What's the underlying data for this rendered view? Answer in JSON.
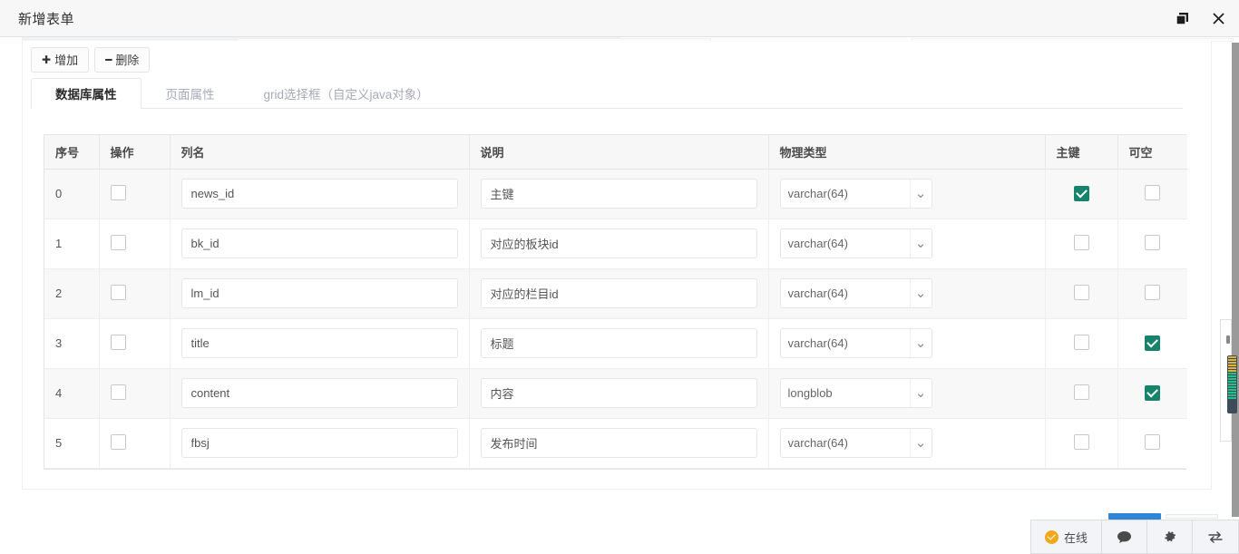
{
  "window": {
    "title": "新增表单",
    "restore_icon": "restore-window-icon",
    "close_icon": "close-icon"
  },
  "toolbar": {
    "add_label": "增加",
    "add_symbol": "✚",
    "delete_label": "删除",
    "delete_symbol": "━"
  },
  "tabs": [
    {
      "label": "数据库属性",
      "active": true
    },
    {
      "label": "页面属性",
      "active": false
    },
    {
      "label": "grid选择框（自定义java对象）",
      "active": false
    }
  ],
  "grid": {
    "columns": [
      {
        "key": "idx",
        "label": "序号"
      },
      {
        "key": "op",
        "label": "操作"
      },
      {
        "key": "col",
        "label": "列名"
      },
      {
        "key": "desc",
        "label": "说明"
      },
      {
        "key": "type",
        "label": "物理类型"
      },
      {
        "key": "pk",
        "label": "主键"
      },
      {
        "key": "null",
        "label": "可空"
      }
    ],
    "type_options": [
      "varchar(64)",
      "longblob"
    ],
    "rows": [
      {
        "idx": "0",
        "col": "news_id",
        "desc": "主键",
        "type": "varchar(64)",
        "pk": true,
        "nullable": false,
        "selected": false
      },
      {
        "idx": "1",
        "col": "bk_id",
        "desc": "对应的板块id",
        "type": "varchar(64)",
        "pk": false,
        "nullable": false,
        "selected": false
      },
      {
        "idx": "2",
        "col": "lm_id",
        "desc": "对应的栏目id",
        "type": "varchar(64)",
        "pk": false,
        "nullable": false,
        "selected": false
      },
      {
        "idx": "3",
        "col": "title",
        "desc": "标题",
        "type": "varchar(64)",
        "pk": false,
        "nullable": true,
        "selected": false
      },
      {
        "idx": "4",
        "col": "content",
        "desc": "内容",
        "type": "longblob",
        "pk": false,
        "nullable": true,
        "selected": false
      },
      {
        "idx": "5",
        "col": "fbsj",
        "desc": "发布时间",
        "type": "varchar(64)",
        "pk": false,
        "nullable": false,
        "selected": false
      }
    ]
  },
  "statusbar": {
    "online_label": "在线",
    "chat_icon": "chat-bubble-icon",
    "settings_icon": "gear-icon",
    "swap_icon": "transfer-arrows-icon"
  },
  "colors": {
    "checkbox_checked": "#18836c",
    "online_badge": "#f3a81b",
    "accent_blue": "#2f86d4",
    "titlebar_bg": "#f7f7f7",
    "row_stripe": "#f8f8f9"
  }
}
